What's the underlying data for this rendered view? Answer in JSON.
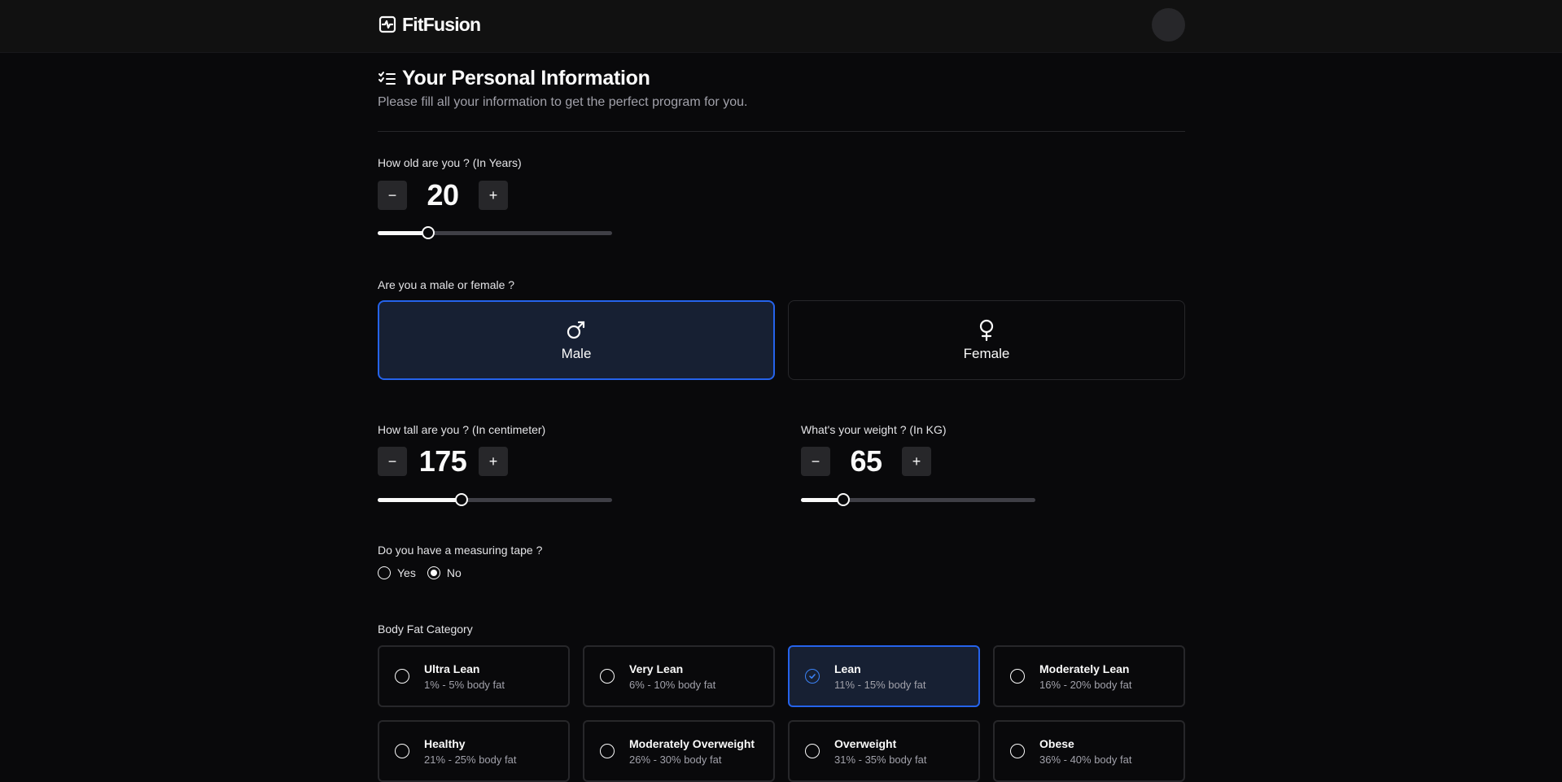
{
  "app": {
    "name": "FitFusion"
  },
  "header": {
    "avatar_icon": "user-avatar"
  },
  "page": {
    "title": "Your Personal Information",
    "subtitle": "Please fill all your information to get the perfect program for you."
  },
  "age": {
    "label": "How old are you ? (In Years)",
    "value": "20",
    "minus": "−",
    "plus": "+",
    "slider_fraction": 0.215
  },
  "gender": {
    "label": "Are you a male or female ?",
    "options": [
      {
        "label": "Male",
        "icon": "male-symbol-icon",
        "selected": true
      },
      {
        "label": "Female",
        "icon": "female-symbol-icon",
        "selected": false
      }
    ]
  },
  "height": {
    "label": "How tall are you ? (In centimeter)",
    "value": "175",
    "minus": "−",
    "plus": "+",
    "slider_fraction": 0.357
  },
  "weight": {
    "label": "What's your weight ? (In KG)",
    "value": "65",
    "minus": "−",
    "plus": "+",
    "slider_fraction": 0.18
  },
  "tape": {
    "label": "Do you have a measuring tape ?",
    "options": [
      {
        "label": "Yes",
        "checked": false
      },
      {
        "label": "No",
        "checked": true
      }
    ]
  },
  "body_fat": {
    "label": "Body Fat Category",
    "options": [
      {
        "name": "Ultra Lean",
        "range": "1% - 5% body fat",
        "selected": false
      },
      {
        "name": "Very Lean",
        "range": "6% - 10% body fat",
        "selected": false
      },
      {
        "name": "Lean",
        "range": "11% - 15% body fat",
        "selected": true
      },
      {
        "name": "Moderately Lean",
        "range": "16% - 20% body fat",
        "selected": false
      },
      {
        "name": "Healthy",
        "range": "21% - 25% body fat",
        "selected": false
      },
      {
        "name": "Moderately Overweight",
        "range": "26% - 30% body fat",
        "selected": false
      },
      {
        "name": "Overweight",
        "range": "31% - 35% body fat",
        "selected": false
      },
      {
        "name": "Obese",
        "range": "36% - 40% body fat",
        "selected": false
      }
    ]
  },
  "colors": {
    "accent": "#2563eb",
    "selected_bg": "#172033",
    "background": "#09090b"
  }
}
